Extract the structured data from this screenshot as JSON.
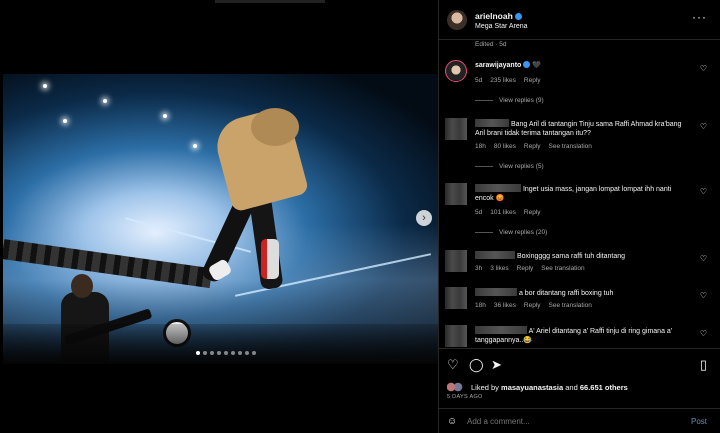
{
  "post": {
    "author": "arielnoah",
    "location": "Mega Star Arena",
    "edited": "Edited · 5d",
    "more": "···"
  },
  "comments": [
    {
      "author": "sarawijayanto",
      "text": "🖤",
      "meta": [
        "5d",
        "235 likes",
        "Reply"
      ],
      "view_replies": "View replies (9)"
    },
    {
      "author": "",
      "text": "Bang Aril di tantangin Tinju sama Raffi Ahmad kra'bang Aril brani tidak terima tantangan itu??",
      "meta": [
        "18h",
        "80 likes",
        "Reply",
        "See translation"
      ],
      "view_replies": "View replies (5)"
    },
    {
      "author": "",
      "text": "Inget usia mass, jangan lompat lompat ihh nanti encok 😡",
      "meta": [
        "5d",
        "101 likes",
        "Reply"
      ],
      "view_replies": "View replies (20)"
    },
    {
      "author": "",
      "text": "Boxingggg sama raffi tuh ditantang",
      "meta": [
        "3h",
        "3 likes",
        "Reply",
        "See translation"
      ]
    },
    {
      "author": "",
      "text": "a bor ditantang raffi boxing tuh",
      "meta": [
        "18h",
        "36 likes",
        "Reply",
        "See translation"
      ]
    },
    {
      "author": "",
      "text": "A' Ariel ditantang a' Raffi tinju di ring gimana a' tanggapannya..😂",
      "meta": []
    }
  ],
  "likes": {
    "prefix": "Liked by",
    "user": "masayuanastasia",
    "middle": "and",
    "others": "66.651 others"
  },
  "date": "5 DAYS AGO",
  "add_comment": {
    "placeholder": "Add a comment...",
    "post_label": "Post"
  },
  "icons": {
    "heart": "heart-icon",
    "comment": "comment-icon",
    "share": "share-icon",
    "save": "bookmark-icon",
    "emoji": "emoji-icon",
    "more": "more-icon",
    "next": "chevron-right-icon"
  },
  "carousel": {
    "slides": 9,
    "active": 1
  },
  "colors": {
    "background": "#000000",
    "verified": "#3897f0",
    "post_disabled": "#6a8ab3"
  }
}
